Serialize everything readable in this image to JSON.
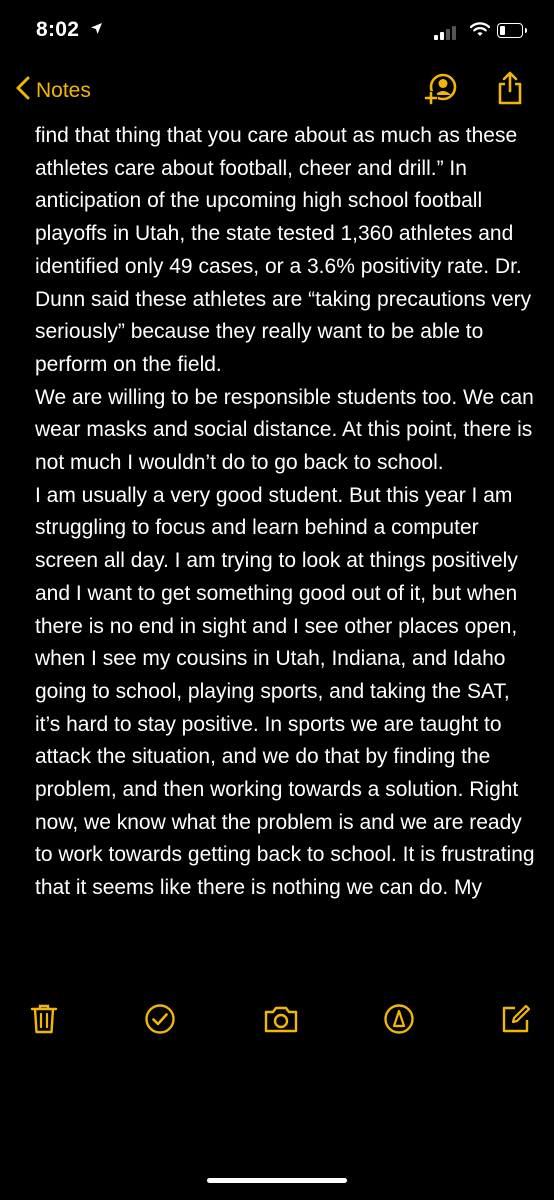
{
  "status_bar": {
    "time": "8:02",
    "icons": [
      "location-arrow-icon",
      "cellular-signal-icon",
      "wifi-icon",
      "battery-icon"
    ]
  },
  "nav": {
    "back_label": "Notes",
    "accent_color": "#f2b705",
    "icons": [
      "add-collaborator-icon",
      "share-icon"
    ]
  },
  "note": {
    "paragraphs": [
      "find that thing that you care about as much as these athletes care about football, cheer and drill.” In anticipation of the upcoming high school football playoffs in Utah, the state tested 1,360 athletes and identified only 49 cases, or a 3.6% positivity rate. Dr. Dunn said these athletes are “taking precautions very seriously” because they really want to be able to perform on the field.",
      "We are willing to be responsible students too. We can wear masks and social distance. At this point, there is not much I wouldn’t do to go back to school.",
      "I am usually a very good student. But this year I am struggling to focus and learn behind a computer screen all day. I am trying to look at things positively and I want to get something good out of it, but when there is no end in sight and I see other places open, when I see my cousins in Utah, Indiana, and Idaho going to school, playing sports, and taking the SAT, it’s hard to stay positive. In sports we are taught to attack the situation, and we do that by finding the problem, and then working towards a solution. Right now, we know what the problem is and we are ready to work towards getting back to school. It is frustrating that it seems like there is nothing we can do. My"
    ]
  },
  "toolbar": {
    "icons": [
      "trash-icon",
      "checklist-icon",
      "camera-icon",
      "markup-pen-icon",
      "compose-icon"
    ]
  }
}
